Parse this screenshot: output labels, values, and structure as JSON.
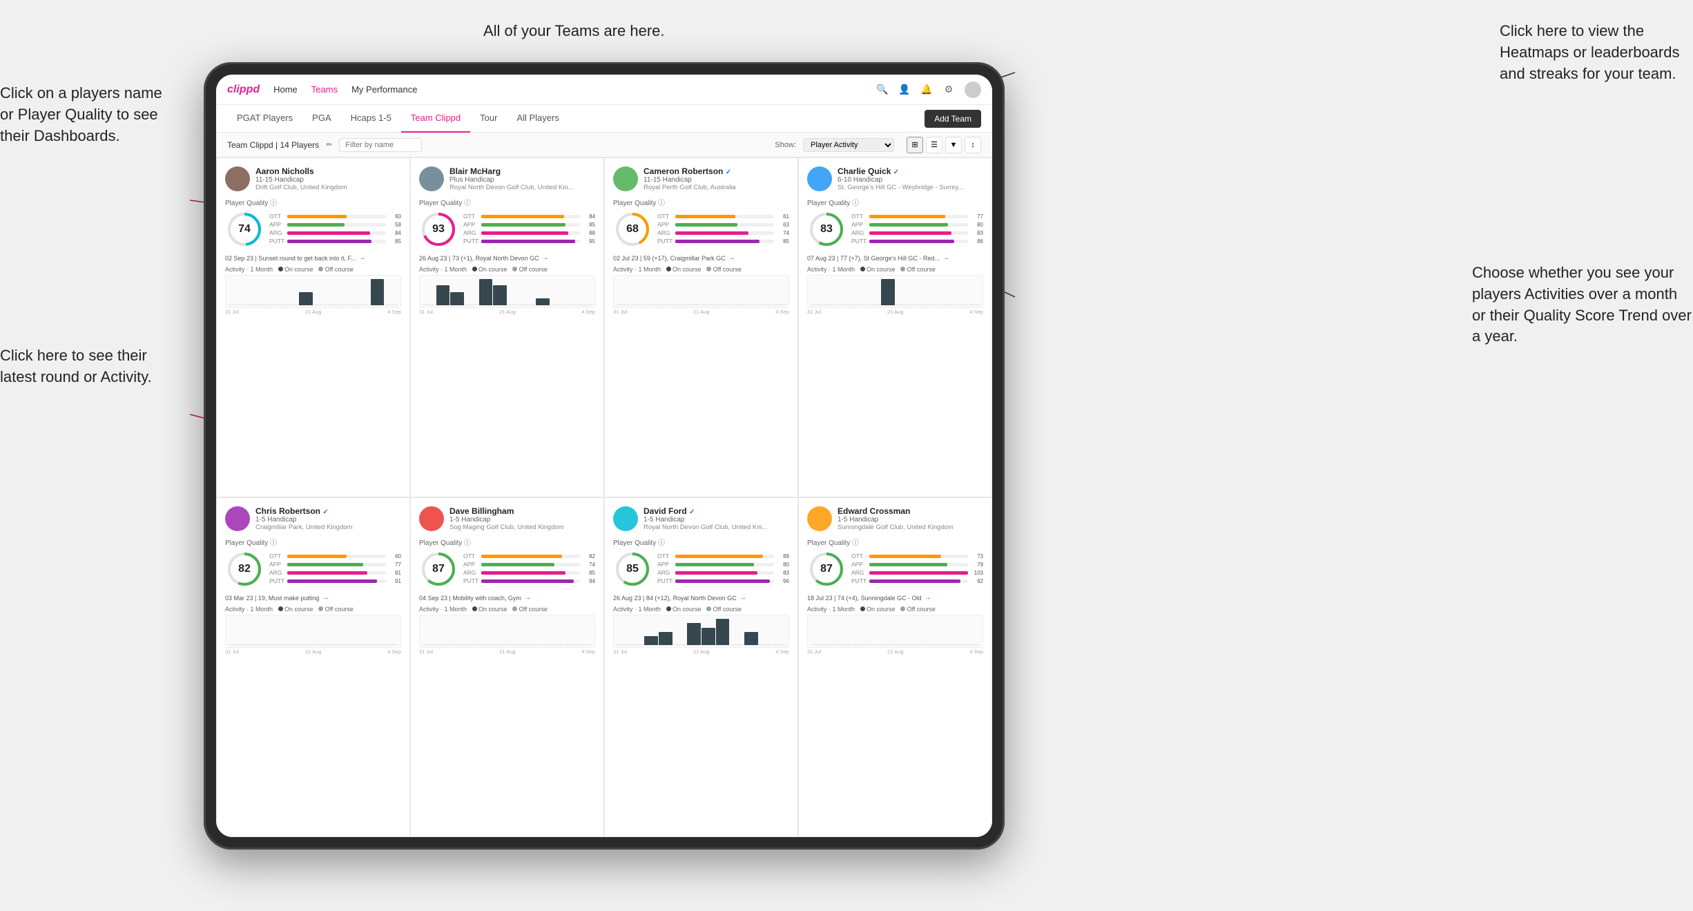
{
  "callouts": {
    "top_left": "Click on a players name\nor Player Quality to see\ntheir Dashboards.",
    "bottom_left": "Click here to see their latest\nround or Activity.",
    "top_center": "All of your Teams are here.",
    "top_right": "Click here to view the\nHeatmaps or leaderboards\nand streaks for your team.",
    "bottom_right": "Choose whether you see\nyour players Activities over\na month or their Quality\nScore Trend over a year."
  },
  "nav": {
    "logo": "clippd",
    "links": [
      "Home",
      "Teams",
      "My Performance"
    ],
    "active_link": "Teams"
  },
  "tabs": {
    "items": [
      "PGAT Players",
      "PGA",
      "Hcaps 1-5",
      "Team Clippd",
      "Tour",
      "All Players"
    ],
    "active": "Team Clippd",
    "add_team": "Add Team"
  },
  "team_header": {
    "label": "Team Clippd | 14 Players",
    "filter_placeholder": "Filter by name",
    "show_label": "Show:",
    "show_options": [
      "Player Activity",
      "Quality Score Trend"
    ]
  },
  "players": [
    {
      "name": "Aaron Nicholls",
      "handicap": "11-15 Handicap",
      "club": "Drift Golf Club, United Kingdom",
      "verified": false,
      "quality": 74,
      "quality_color": "#00bcd4",
      "ott": 60,
      "app": 58,
      "arg": 84,
      "putt": 85,
      "latest_round": "02 Sep 23 | Sunset round to get back into it, F...",
      "chart_bars": [
        0,
        0,
        0,
        0,
        0,
        1,
        0,
        0,
        0,
        0,
        2,
        0
      ],
      "chart_dates": [
        "31 Jul",
        "21 Aug",
        "4 Sep"
      ]
    },
    {
      "name": "Blair McHarg",
      "handicap": "Plus Handicap",
      "club": "Royal North Devon Golf Club, United Kin...",
      "verified": false,
      "quality": 93,
      "quality_color": "#e91e8c",
      "ott": 84,
      "app": 85,
      "arg": 88,
      "putt": 95,
      "latest_round": "26 Aug 23 | 73 (+1), Royal North Devon GC",
      "chart_bars": [
        0,
        3,
        2,
        0,
        4,
        3,
        0,
        0,
        1,
        0,
        0,
        0
      ],
      "chart_dates": [
        "31 Jul",
        "21 Aug",
        "4 Sep"
      ]
    },
    {
      "name": "Cameron Robertson",
      "handicap": "11-15 Handicap",
      "club": "Royal Perth Golf Club, Australia",
      "verified": true,
      "quality": 68,
      "quality_color": "#ff9800",
      "ott": 61,
      "app": 63,
      "arg": 74,
      "putt": 85,
      "latest_round": "02 Jul 23 | 59 (+17), Craigmillar Park GC",
      "chart_bars": [
        0,
        0,
        0,
        0,
        0,
        0,
        0,
        0,
        0,
        0,
        0,
        0
      ],
      "chart_dates": [
        "31 Jul",
        "21 Aug",
        "4 Sep"
      ]
    },
    {
      "name": "Charlie Quick",
      "handicap": "6-10 Handicap",
      "club": "St. George's Hill GC - Weybridge - Surrey...",
      "verified": true,
      "quality": 83,
      "quality_color": "#4caf50",
      "ott": 77,
      "app": 80,
      "arg": 83,
      "putt": 86,
      "latest_round": "07 Aug 23 | 77 (+7), St George's Hill GC - Red...",
      "chart_bars": [
        0,
        0,
        0,
        0,
        0,
        2,
        0,
        0,
        0,
        0,
        0,
        0
      ],
      "chart_dates": [
        "31 Jul",
        "21 Aug",
        "4 Sep"
      ]
    },
    {
      "name": "Chris Robertson",
      "handicap": "1-5 Handicap",
      "club": "Craigmillar Park, United Kingdom",
      "verified": true,
      "quality": 82,
      "quality_color": "#4caf50",
      "ott": 60,
      "app": 77,
      "arg": 81,
      "putt": 91,
      "latest_round": "03 Mar 23 | 19, Must make putting",
      "chart_bars": [
        0,
        0,
        0,
        0,
        0,
        0,
        0,
        0,
        0,
        0,
        0,
        0
      ],
      "chart_dates": [
        "31 Jul",
        "21 Aug",
        "4 Sep"
      ]
    },
    {
      "name": "Dave Billingham",
      "handicap": "1-5 Handicap",
      "club": "Sog Maging Golf Club, United Kingdom",
      "verified": false,
      "quality": 87,
      "quality_color": "#4caf50",
      "ott": 82,
      "app": 74,
      "arg": 85,
      "putt": 94,
      "latest_round": "04 Sep 23 | Mobility with coach, Gym",
      "chart_bars": [
        0,
        0,
        0,
        0,
        0,
        0,
        0,
        0,
        0,
        0,
        0,
        0
      ],
      "chart_dates": [
        "31 Jul",
        "21 Aug",
        "4 Sep"
      ]
    },
    {
      "name": "David Ford",
      "handicap": "1-5 Handicap",
      "club": "Royal North Devon Golf Club, United Kni...",
      "verified": true,
      "quality": 85,
      "quality_color": "#4caf50",
      "ott": 89,
      "app": 80,
      "arg": 83,
      "putt": 96,
      "latest_round": "26 Aug 23 | 84 (+12), Royal North Devon GC",
      "chart_bars": [
        0,
        0,
        2,
        3,
        0,
        5,
        4,
        6,
        0,
        3,
        0,
        0
      ],
      "chart_dates": [
        "31 Jul",
        "21 Aug",
        "4 Sep"
      ]
    },
    {
      "name": "Edward Crossman",
      "handicap": "1-5 Handicap",
      "club": "Sunningdale Golf Club, United Kingdom",
      "verified": false,
      "quality": 87,
      "quality_color": "#4caf50",
      "ott": 73,
      "app": 79,
      "arg": 103,
      "putt": 92,
      "latest_round": "18 Jul 23 | 74 (+4), Sunningdale GC - Old",
      "chart_bars": [
        0,
        0,
        0,
        0,
        0,
        0,
        0,
        0,
        0,
        0,
        0,
        0
      ],
      "chart_dates": [
        "31 Jul",
        "21 Aug",
        "4 Sep"
      ]
    }
  ],
  "bar_colors": {
    "ott": "#ff9800",
    "app": "#4caf50",
    "arg": "#e91e8c",
    "putt": "#9c27b0"
  }
}
